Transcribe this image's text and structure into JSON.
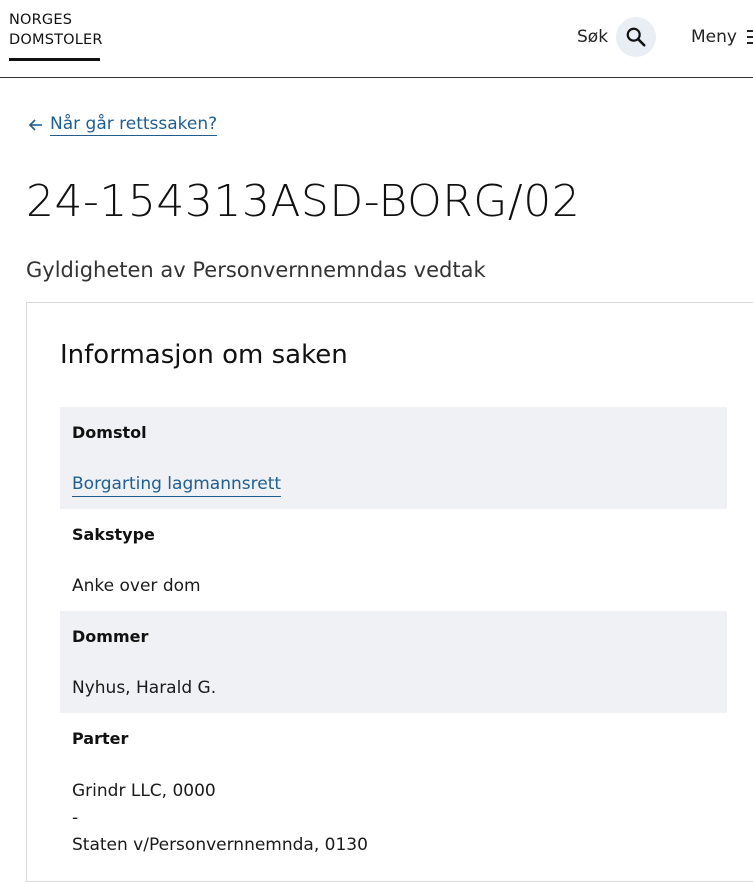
{
  "header": {
    "logo_line1": "NORGES",
    "logo_line2": "DOMSTOLER",
    "search_label": "Søk",
    "menu_label": "Meny"
  },
  "back_link": {
    "label": "Når går rettssaken?"
  },
  "case": {
    "number": "24-154313ASD-BORG/02",
    "subject": "Gyldigheten av Personvernnemndas vedtak"
  },
  "info": {
    "title": "Informasjon om saken",
    "court_label": "Domstol",
    "court_value": "Borgarting lagmannsrett",
    "case_type_label": "Sakstype",
    "case_type_value": "Anke over dom",
    "judge_label": "Dommer",
    "judge_value": "Nyhus, Harald G.",
    "parties_label": "Parter",
    "party_1": "Grindr LLC, 0000",
    "separator": "-",
    "party_2": "Staten v/Personvernnemnda, 0130"
  },
  "colors": {
    "link": "#1f5e8f",
    "row_shade": "#eff1f4",
    "search_circle": "#e8eef4"
  },
  "icons": [
    "search-icon",
    "menu-icon",
    "arrow-left-icon"
  ]
}
